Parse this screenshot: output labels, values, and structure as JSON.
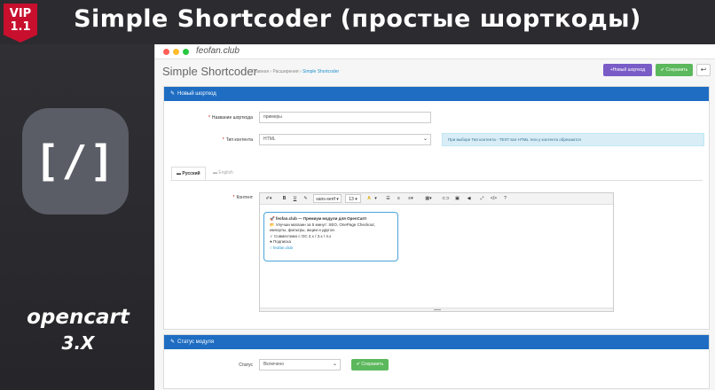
{
  "banner": {
    "title": "Simple Shortcoder (простые шорткоды)",
    "vip_line1": "VIP",
    "vip_line2": "1.1"
  },
  "left": {
    "icon_glyph": "[/]",
    "platform": "opencart",
    "version": "3.X"
  },
  "window": {
    "url": "feofan.club"
  },
  "header": {
    "title": "Simple Shortcoder",
    "breadcrumb": [
      "Главная",
      "Расширения",
      "Simple Shortcoder"
    ],
    "btn_new": "+Новый шорткод",
    "btn_save": "✔ Сохранить",
    "btn_back": "↩"
  },
  "new_panel": {
    "title": "Новый шорткод",
    "name_label": "Название шорткода",
    "name_value": "примеры",
    "type_label": "Тип контента",
    "type_value": "HTML",
    "info_text": "При выборе Тип контента - TEXT все HTML теги у контента обрезаются",
    "tabs": [
      "Русский",
      "English"
    ],
    "content_label": "Контент",
    "toolbar": {
      "font": "sans-serif ▾",
      "size": "13 ▾",
      "bold": "B",
      "underline": "U",
      "eraser": "✎"
    },
    "content_lines": [
      "🚀 feofan.club — Премиум модули для OpenCart!",
      "📂 Улучши магазин за 5 минут: SEO, OnePage Checkout,",
      "импорты, фильтры, акции и другое.",
      "✓ Совместимо с OC 2.x / 3.x / 4.x",
      "● Подписка",
      "○ feofan.club"
    ]
  },
  "status_panel": {
    "title": "Статус модуля",
    "status_label": "Статус",
    "status_value": "Включено",
    "save_label": "✔ Сохранить"
  },
  "colors": {
    "primary": "#1e6dc2",
    "new_button": "#7a5cc7",
    "save_button": "#5cb85c",
    "vip": "#c8102e"
  }
}
